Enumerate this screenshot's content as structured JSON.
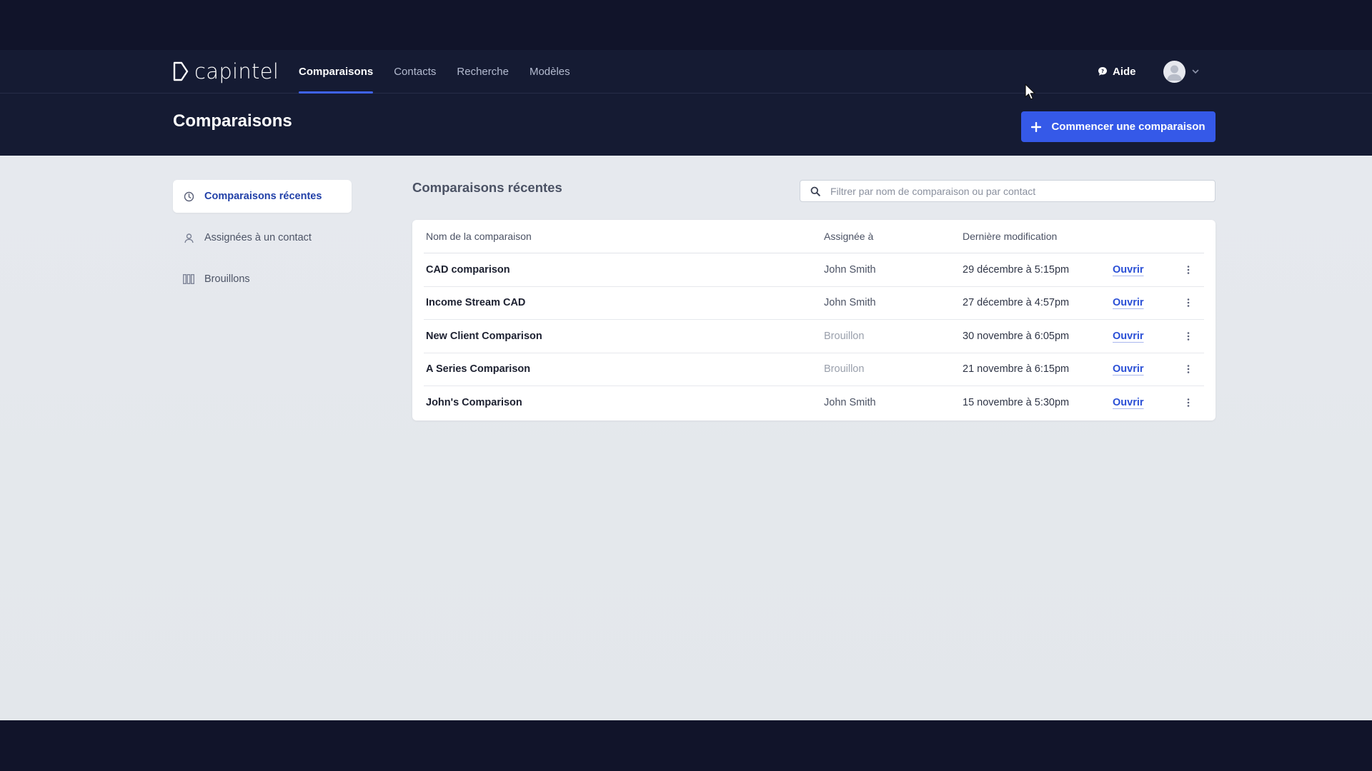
{
  "app": {
    "brand_name": "capintel",
    "nav": [
      {
        "label": "Comparaisons",
        "active": true
      },
      {
        "label": "Contacts",
        "active": false
      },
      {
        "label": "Recherche",
        "active": false
      },
      {
        "label": "Modèles",
        "active": false
      }
    ],
    "help_label": "Aide"
  },
  "header": {
    "title": "Comparaisons",
    "primary_button": "Commencer une comparaison"
  },
  "sidebar": {
    "items": [
      {
        "label": "Comparaisons récentes",
        "icon": "clock-icon",
        "active": true
      },
      {
        "label": "Assignées à un contact",
        "icon": "user-icon",
        "active": false
      },
      {
        "label": "Brouillons",
        "icon": "columns-icon",
        "active": false
      }
    ]
  },
  "main": {
    "section_title": "Comparaisons récentes",
    "search_placeholder": "Filtrer par nom de comparaison ou par contact",
    "table": {
      "columns": [
        "Nom de la comparaison",
        "Assignée à",
        "Dernière modification"
      ],
      "open_label": "Ouvrir",
      "rows": [
        {
          "name": "CAD comparison",
          "assigned": "John Smith",
          "modified": "29 décembre à 5:15pm",
          "draft": false
        },
        {
          "name": "Income Stream CAD",
          "assigned": "John Smith",
          "modified": "27 décembre à 4:57pm",
          "draft": false
        },
        {
          "name": "New Client Comparison",
          "assigned": "Brouillon",
          "modified": "30 novembre à 6:05pm",
          "draft": true
        },
        {
          "name": "A Series Comparison",
          "assigned": "Brouillon",
          "modified": "21 novembre à 6:15pm",
          "draft": true
        },
        {
          "name": "John's Comparison",
          "assigned": "John Smith",
          "modified": "15 novembre à 5:30pm",
          "draft": false
        }
      ]
    }
  },
  "colors": {
    "nav_bg": "#151b33",
    "accent": "#3559e8",
    "link": "#2a4fd6",
    "content_bg": "#e6e9ee"
  }
}
